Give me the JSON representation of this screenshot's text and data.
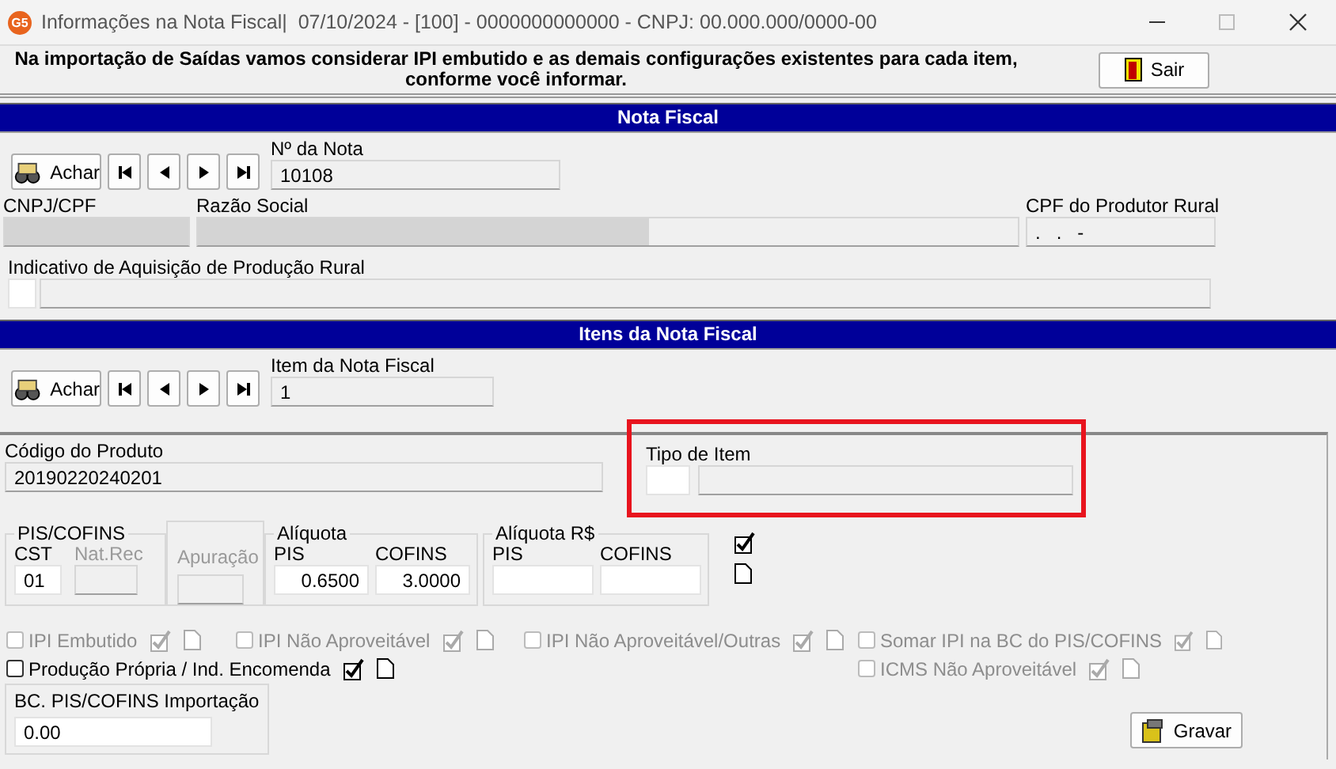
{
  "window": {
    "app_badge": "G5",
    "title": "Informações na Nota Fiscal|  07/10/2024 - [100] - 0000000000000 - CNPJ: 00.000.000/0000-00"
  },
  "notice": {
    "text": "Na importação de Saídas vamos considerar IPI embutido e as demais configurações existentes para cada item, conforme você informar.",
    "button": "Sair"
  },
  "nota_fiscal": {
    "header": "Nota Fiscal",
    "find_button": "Achar",
    "number": {
      "label": "Nº da Nota",
      "value": "10108"
    },
    "cnpj": {
      "label": "CNPJ/CPF"
    },
    "razao_social": {
      "label": "Razão Social"
    },
    "cpf_produtor": {
      "label": "CPF do Produtor Rural",
      "value": ".   .   -"
    },
    "indicativo": {
      "label": "Indicativo de Aquisição de Produção Rural"
    }
  },
  "itens": {
    "header": "Itens da Nota Fiscal",
    "find_button": "Achar",
    "item": {
      "label": "Item da Nota Fiscal",
      "value": "1"
    },
    "codigo": {
      "label": "Código do Produto",
      "value": "20190220240201"
    },
    "tipo_item": {
      "label": "Tipo de Item",
      "highlighted": true
    },
    "pis_cofins": {
      "title": "PIS/COFINS",
      "cst_label": "CST",
      "cst_value": "01",
      "natrec_label": "Nat.Rec",
      "natrec_disabled": true
    },
    "apuracao": {
      "label": "Apuração",
      "disabled": true
    },
    "aliquota": {
      "title": "Alíquota",
      "pis_label": "PIS",
      "pis_value": "0.6500",
      "cofins_label": "COFINS",
      "cofins_value": "3.0000"
    },
    "aliquota_rs": {
      "title": "Alíquota R$",
      "pis_label": "PIS",
      "cofins_label": "COFINS"
    },
    "options": [
      {
        "label": "IPI Embutido",
        "checked": false,
        "disabled": true
      },
      {
        "label": "IPI Não Aproveitável",
        "checked": false,
        "disabled": true
      },
      {
        "label": "IPI Não Aproveitável/Outras",
        "checked": false,
        "disabled": true
      },
      {
        "label": "Somar IPI na BC do PIS/COFINS",
        "checked": false,
        "disabled": true
      },
      {
        "label": "Produção Própria / Ind. Encomenda",
        "checked": false,
        "disabled": false
      },
      {
        "label": "ICMS Não Aproveitável",
        "checked": false,
        "disabled": true
      }
    ],
    "bc_importacao": {
      "label": "BC. PIS/COFINS Importação",
      "value": "0.00"
    },
    "save_button": "Gravar"
  }
}
